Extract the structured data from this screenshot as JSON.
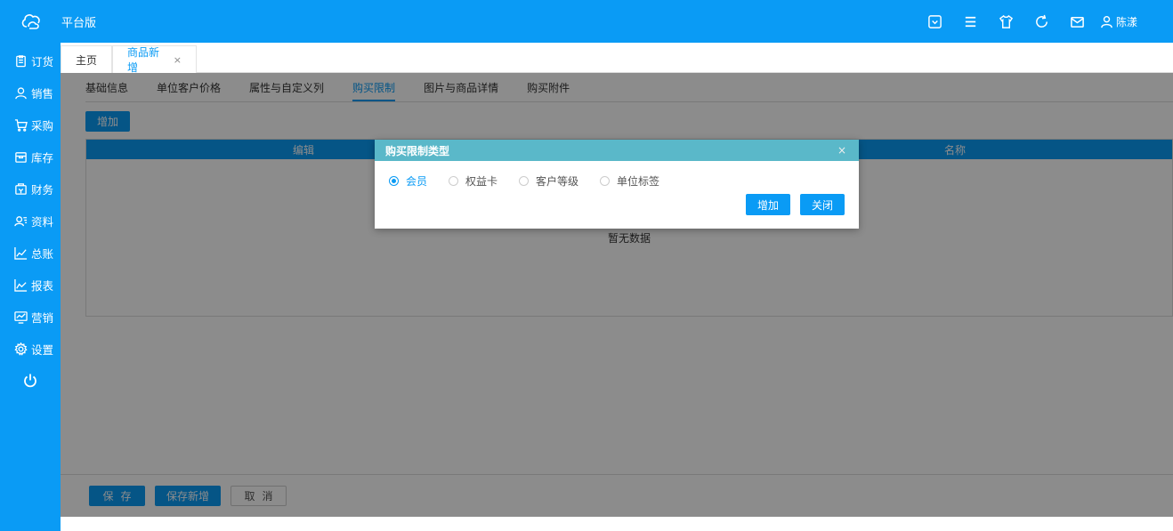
{
  "header": {
    "brand": "平台版",
    "user_name": "陈漾",
    "icons": [
      "inbox-icon",
      "menu-icon",
      "shirt-icon",
      "refresh-icon",
      "mail-icon",
      "user-icon"
    ]
  },
  "sidebar": {
    "items": [
      {
        "label": "订货",
        "icon": "clipboard-icon"
      },
      {
        "label": "销售",
        "icon": "person-icon"
      },
      {
        "label": "采购",
        "icon": "cart-icon"
      },
      {
        "label": "库存",
        "icon": "box-icon"
      },
      {
        "label": "财务",
        "icon": "wallet-icon"
      },
      {
        "label": "资料",
        "icon": "contacts-icon"
      },
      {
        "label": "总账",
        "icon": "chart-icon"
      },
      {
        "label": "报表",
        "icon": "report-icon"
      },
      {
        "label": "营销",
        "icon": "monitor-icon"
      },
      {
        "label": "设置",
        "icon": "gear-icon"
      }
    ],
    "power_icon": "power-icon"
  },
  "tabs": {
    "home": "主页",
    "active": "商品新增",
    "close": "×"
  },
  "subtabs": [
    "基础信息",
    "单位客户价格",
    "属性与自定义列",
    "购买限制",
    "图片与商品详情",
    "购买附件"
  ],
  "toolbar": {
    "add_label": "增加"
  },
  "table": {
    "columns": [
      "编辑",
      "名称"
    ],
    "empty_text": "暂无数据"
  },
  "footer": {
    "save": "保存",
    "save_new": "保存新增",
    "cancel": "取消"
  },
  "dialog": {
    "title": "购买限制类型",
    "close": "×",
    "options": [
      "会员",
      "权益卡",
      "客户等级",
      "单位标签"
    ],
    "selected": "会员",
    "add_label": "增加",
    "close_label": "关闭"
  },
  "colors": {
    "primary": "#0a9bf5",
    "dialog_header": "#5ab8c9"
  }
}
